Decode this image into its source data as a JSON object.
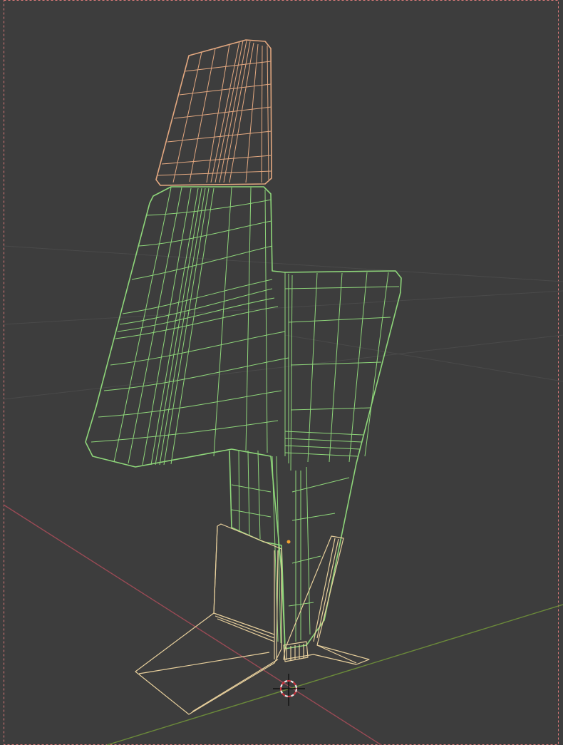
{
  "viewport": {
    "mode": "wireframe",
    "background_color": "#3d3d3d",
    "frame_border_color": "#e07a7a"
  },
  "axes": {
    "x_color": "#9a4a55",
    "y_color": "#6b8a3a",
    "grid_color": "#4a4a4a"
  },
  "objects": [
    {
      "name": "headrest",
      "state": "selected",
      "wire_color": "#e3a880"
    },
    {
      "name": "seat-body",
      "state": "active",
      "wire_color": "#8ed67a"
    },
    {
      "name": "base-stand",
      "state": "selected",
      "wire_color": "#e7cf9c"
    }
  ],
  "cursor": {
    "icon": "3d-cursor-icon"
  },
  "origin": {
    "icon": "object-origin-icon",
    "color": "#f0a030"
  }
}
